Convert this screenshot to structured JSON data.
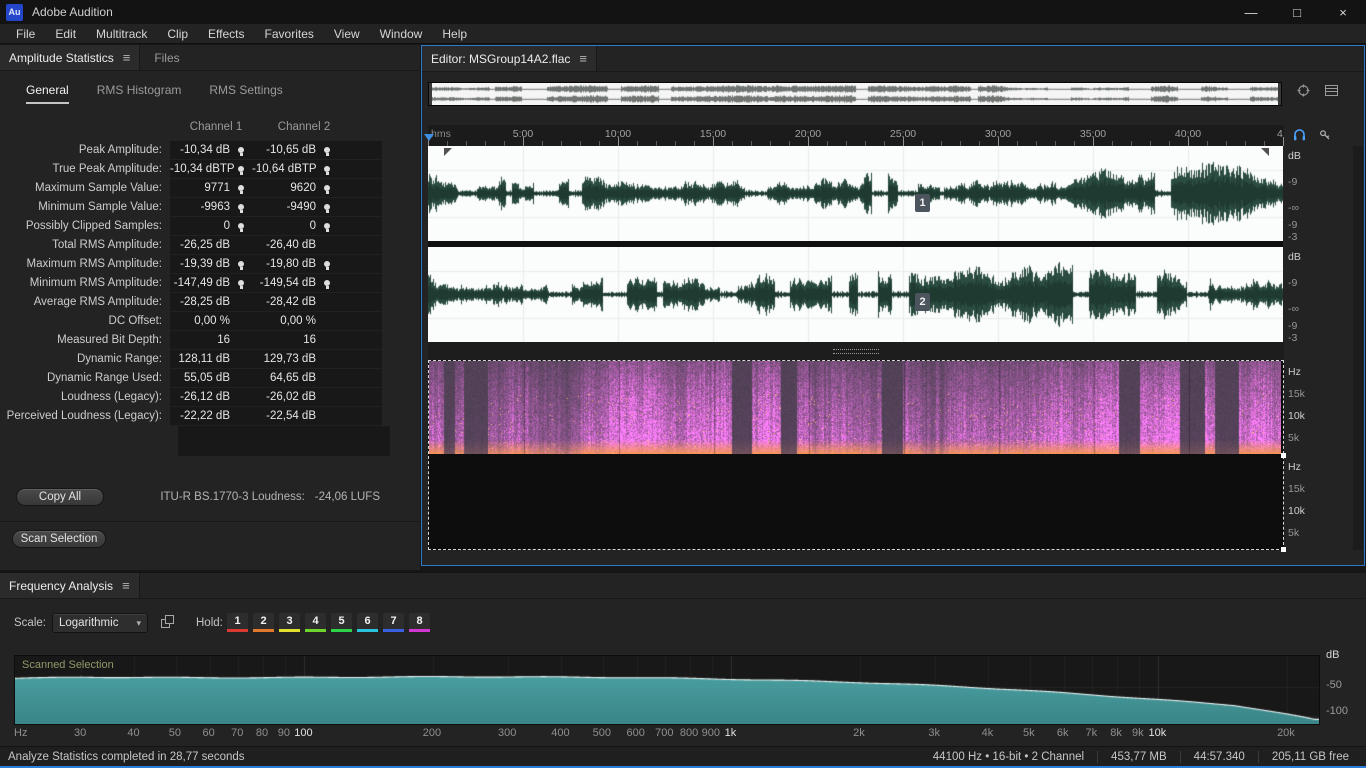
{
  "titlebar": {
    "logo": "Au",
    "app": "Adobe Audition"
  },
  "icons": {
    "hamburger": "≡",
    "chevron": "▾",
    "minimize": "—",
    "maximize": "□",
    "close": "×"
  },
  "menus": [
    "File",
    "Edit",
    "Multitrack",
    "Clip",
    "Effects",
    "Favorites",
    "View",
    "Window",
    "Help"
  ],
  "stats_panel": {
    "tab": "Amplitude Statistics",
    "tab_files": "Files",
    "subtabs": [
      "General",
      "RMS Histogram",
      "RMS Settings"
    ],
    "col1": "Channel 1",
    "col2": "Channel 2",
    "rows": [
      {
        "label": "Peak Amplitude:",
        "ch1": "-10,34 dB",
        "ch2": "-10,65 dB",
        "bulb": true
      },
      {
        "label": "True Peak Amplitude:",
        "ch1": "-10,34 dBTP",
        "ch2": "-10,64 dBTP",
        "bulb": true
      },
      {
        "label": "Maximum Sample Value:",
        "ch1": "9771",
        "ch2": "9620",
        "bulb": true
      },
      {
        "label": "Minimum Sample Value:",
        "ch1": "-9963",
        "ch2": "-9490",
        "bulb": true
      },
      {
        "label": "Possibly Clipped Samples:",
        "ch1": "0",
        "ch2": "0",
        "bulb": true
      },
      {
        "label": "Total RMS Amplitude:",
        "ch1": "-26,25 dB",
        "ch2": "-26,40 dB",
        "bulb": false
      },
      {
        "label": "Maximum RMS Amplitude:",
        "ch1": "-19,39 dB",
        "ch2": "-19,80 dB",
        "bulb": true
      },
      {
        "label": "Minimum RMS Amplitude:",
        "ch1": "-147,49 dB",
        "ch2": "-149,54 dB",
        "bulb": true
      },
      {
        "label": "Average RMS Amplitude:",
        "ch1": "-28,25 dB",
        "ch2": "-28,42 dB",
        "bulb": false
      },
      {
        "label": "DC Offset:",
        "ch1": "0,00 %",
        "ch2": "0,00 %",
        "bulb": false
      },
      {
        "label": "Measured Bit Depth:",
        "ch1": "16",
        "ch2": "16",
        "bulb": false
      },
      {
        "label": "Dynamic Range:",
        "ch1": "128,11 dB",
        "ch2": "129,73 dB",
        "bulb": false
      },
      {
        "label": "Dynamic Range Used:",
        "ch1": "55,05 dB",
        "ch2": "64,65 dB",
        "bulb": false
      },
      {
        "label": "Loudness (Legacy):",
        "ch1": "-26,12 dB",
        "ch2": "-26,02 dB",
        "bulb": false
      },
      {
        "label": "Perceived Loudness (Legacy):",
        "ch1": "-22,22 dB",
        "ch2": "-22,54 dB",
        "bulb": false
      }
    ],
    "copy_all": "Copy All",
    "loudness_label": "ITU-R BS.1770-3 Loudness:",
    "loudness_value": "-24,06 LUFS",
    "scan": "Scan Selection"
  },
  "editor": {
    "tab": "Editor: MSGroup14A2.flac",
    "ruler_unit": "hms",
    "ruler_ticks": [
      "5:00",
      "10:00",
      "15:00",
      "20:00",
      "25:00",
      "30:00",
      "35:00",
      "40:00",
      "4"
    ],
    "db_scale": [
      "dB",
      "-9",
      "-∞",
      "-9",
      "-3"
    ],
    "hz_scale": [
      "Hz",
      "15k",
      "10k",
      "5k"
    ],
    "channel_badges": [
      "1",
      "2"
    ]
  },
  "freq_panel": {
    "tab": "Frequency Analysis",
    "scale_label": "Scale:",
    "scale_value": "Logarithmic",
    "hold_label": "Hold:",
    "hold_buttons": [
      {
        "label": "1",
        "color": "#d93a31"
      },
      {
        "label": "2",
        "color": "#e2792b"
      },
      {
        "label": "3",
        "color": "#e3df2d"
      },
      {
        "label": "4",
        "color": "#6fd42b"
      },
      {
        "label": "5",
        "color": "#2bd448"
      },
      {
        "label": "6",
        "color": "#2bc4de"
      },
      {
        "label": "7",
        "color": "#3a5fe0"
      },
      {
        "label": "8",
        "color": "#d336d3"
      }
    ],
    "graph_label": "Scanned Selection",
    "db_labels": [
      "dB",
      "-50",
      "-100"
    ],
    "freq_ticks": [
      {
        "label": "Hz",
        "f": null
      },
      {
        "label": "30",
        "f": 30
      },
      {
        "label": "40",
        "f": 40
      },
      {
        "label": "50",
        "f": 50
      },
      {
        "label": "60",
        "f": 60
      },
      {
        "label": "70",
        "f": 70
      },
      {
        "label": "80",
        "f": 80
      },
      {
        "label": "90",
        "f": 90
      },
      {
        "label": "100",
        "f": 100,
        "bold": true
      },
      {
        "label": "200",
        "f": 200
      },
      {
        "label": "300",
        "f": 300
      },
      {
        "label": "400",
        "f": 400
      },
      {
        "label": "500",
        "f": 500
      },
      {
        "label": "600",
        "f": 600
      },
      {
        "label": "700",
        "f": 700
      },
      {
        "label": "800",
        "f": 800
      },
      {
        "label": "900",
        "f": 900
      },
      {
        "label": "1k",
        "f": 1000,
        "bold": true
      },
      {
        "label": "2k",
        "f": 2000
      },
      {
        "label": "3k",
        "f": 3000
      },
      {
        "label": "4k",
        "f": 4000
      },
      {
        "label": "5k",
        "f": 5000
      },
      {
        "label": "6k",
        "f": 6000
      },
      {
        "label": "7k",
        "f": 7000
      },
      {
        "label": "8k",
        "f": 8000
      },
      {
        "label": "9k",
        "f": 9000
      },
      {
        "label": "10k",
        "f": 10000,
        "bold": true
      },
      {
        "label": "20k",
        "f": 20000
      }
    ]
  },
  "statusbar": {
    "left": "Analyze Statistics completed in 28,77 seconds",
    "format": "44100 Hz • 16-bit • 2 Channel",
    "size": "453,77 MB",
    "duration": "44:57.340",
    "free": "205,11 GB free"
  }
}
